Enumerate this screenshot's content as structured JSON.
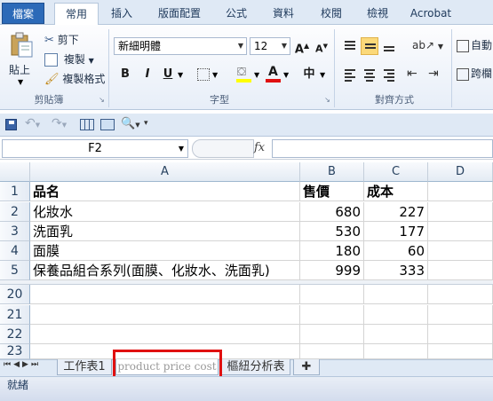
{
  "ribbon_tabs": [
    "檔案",
    "常用",
    "插入",
    "版面配置",
    "公式",
    "資料",
    "校閱",
    "檢視",
    "Acrobat"
  ],
  "clipboard": {
    "paste": "貼上",
    "cut": "剪下",
    "copy": "複製",
    "format_painter": "複製格式",
    "label": "剪貼簿"
  },
  "font": {
    "name": "新細明體",
    "size": "12",
    "label": "字型",
    "grow": "A",
    "shrink": "A",
    "bold": "B",
    "italic": "I",
    "underline": "U",
    "font_color": "A",
    "phonetic": "中"
  },
  "alignment": {
    "label": "對齊方式"
  },
  "wrap": {
    "label1": "自動",
    "label2": "跨欄"
  },
  "formula_bar": {
    "name_box": "F2",
    "fx": "fx",
    "value": ""
  },
  "columns": [
    "A",
    "B",
    "C",
    "D"
  ],
  "rows": [
    {
      "num": "1",
      "name": "品名",
      "price": "售價",
      "cost": "成本",
      "bold": true
    },
    {
      "num": "2",
      "name": "化妝水",
      "price": "680",
      "cost": "227"
    },
    {
      "num": "3",
      "name": "洗面乳",
      "price": "530",
      "cost": "177"
    },
    {
      "num": "4",
      "name": "面膜",
      "price": "180",
      "cost": "60"
    },
    {
      "num": "5",
      "name": "保養品組合系列(面膜、化妝水、洗面乳)",
      "price": "999",
      "cost": "333"
    },
    {
      "num": "20",
      "name": "",
      "price": "",
      "cost": ""
    },
    {
      "num": "21",
      "name": "",
      "price": "",
      "cost": ""
    },
    {
      "num": "22",
      "name": "",
      "price": "",
      "cost": ""
    },
    {
      "num": "23",
      "name": "",
      "price": "",
      "cost": ""
    }
  ],
  "sheet_tabs": [
    "工作表1",
    "product price cost",
    "樞紐分析表"
  ],
  "status": "就緒",
  "colors": {
    "accent": "#2c6ab8",
    "highlight": "#e01010",
    "selected_align": "#fbd97a"
  }
}
